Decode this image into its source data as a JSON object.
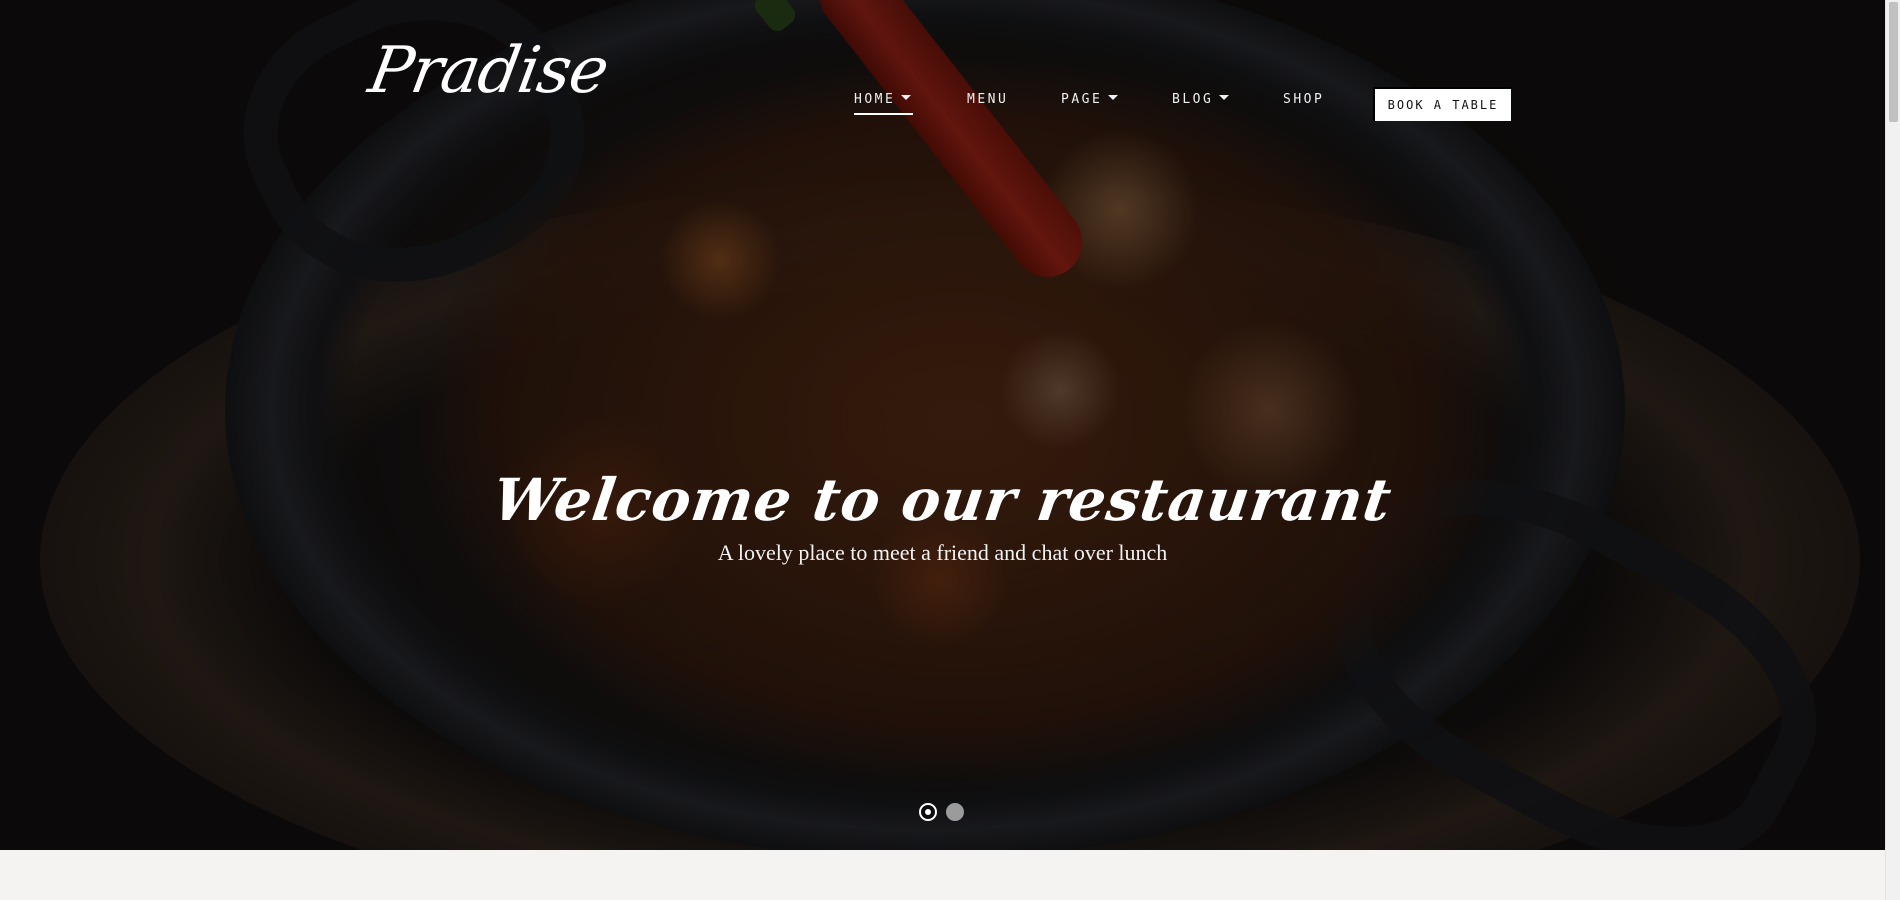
{
  "brand": {
    "logo_text": "Pradise"
  },
  "nav": {
    "items": [
      {
        "label": "HOME",
        "has_dropdown": true,
        "active": true
      },
      {
        "label": "MENU",
        "has_dropdown": false,
        "active": false
      },
      {
        "label": "PAGE",
        "has_dropdown": true,
        "active": false
      },
      {
        "label": "BLOG",
        "has_dropdown": true,
        "active": false
      },
      {
        "label": "SHOP",
        "has_dropdown": false,
        "active": false
      }
    ],
    "cta_label": "BOOK A TABLE"
  },
  "hero": {
    "title": "Welcome to our restaurant",
    "subtitle": "A lovely place to meet a friend and chat over lunch",
    "slide_count": 2,
    "active_slide": 1
  },
  "colors": {
    "text": "#ffffff",
    "overlay": "#000000",
    "cta_background": "#ffffff",
    "page_background": "#f4f3f1"
  }
}
